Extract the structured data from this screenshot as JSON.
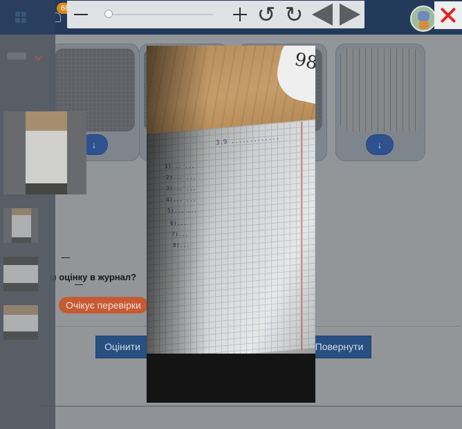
{
  "header": {
    "notification_count": "68"
  },
  "submission": {
    "journal_question": "м оцінку в журнал?",
    "status_badge": "Очікує перевірки",
    "dash_1": "—",
    "dash_2": "—"
  },
  "actions": {
    "grade_label": "Оцінити",
    "return_label": "Повернути"
  },
  "viewer": {
    "download_glyph": "↓",
    "rotate_left_glyph": "↺",
    "rotate_right_glyph": "↻"
  },
  "colors": {
    "header_bg": "#243a5a",
    "status_badge": "#c65a33",
    "action_button": "#274f80",
    "close_icon": "#e2231a"
  }
}
